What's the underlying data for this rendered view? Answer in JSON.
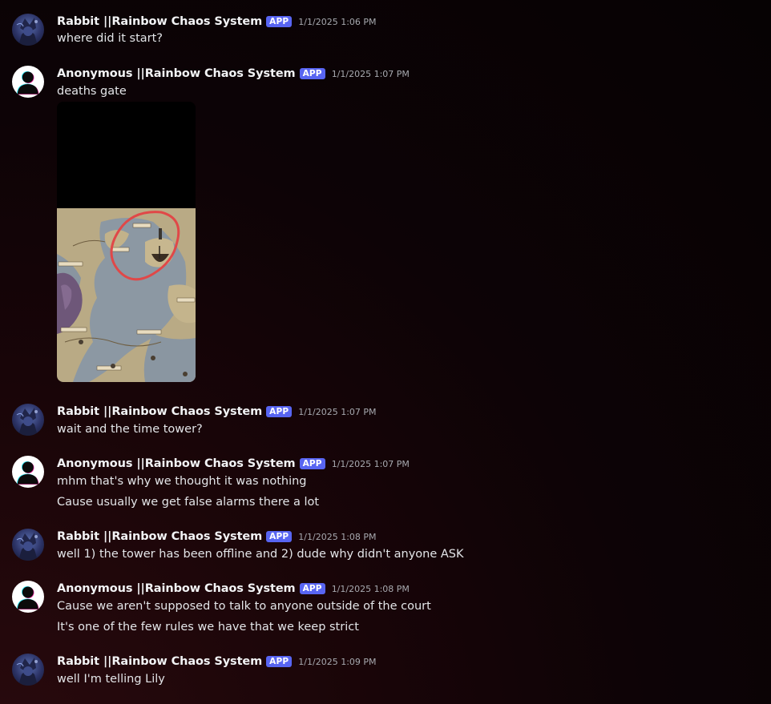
{
  "messages": [
    {
      "author": "Rabbit ||Rainbow Chaos System",
      "badge": "APP",
      "timestamp": "1/1/2025 1:06 PM",
      "lines": [
        "where did it start?"
      ]
    },
    {
      "author": "Anonymous ||Rainbow Chaos System",
      "badge": "APP",
      "timestamp": "1/1/2025 1:07 PM",
      "lines": [
        "deaths gate"
      ],
      "attachment": {
        "kind": "image",
        "subject": "map-with-red-circle"
      }
    },
    {
      "author": "Rabbit ||Rainbow Chaos System",
      "badge": "APP",
      "timestamp": "1/1/2025 1:07 PM",
      "lines": [
        "wait and the time tower?"
      ]
    },
    {
      "author": "Anonymous ||Rainbow Chaos System",
      "badge": "APP",
      "timestamp": "1/1/2025 1:07 PM",
      "lines": [
        "mhm that's why we thought it was nothing",
        "Cause usually we get false alarms there a lot"
      ]
    },
    {
      "author": "Rabbit ||Rainbow Chaos System",
      "badge": "APP",
      "timestamp": "1/1/2025 1:08 PM",
      "lines": [
        "well 1) the tower has been offline and 2) dude why didn't anyone ASK"
      ]
    },
    {
      "author": "Anonymous ||Rainbow Chaos System",
      "badge": "APP",
      "timestamp": "1/1/2025 1:08 PM",
      "lines": [
        "Cause we aren't supposed to talk to anyone outside of the court",
        "It's one of the few rules we have that we keep strict"
      ]
    },
    {
      "author": "Rabbit ||Rainbow Chaos System",
      "badge": "APP",
      "timestamp": "1/1/2025 1:09 PM",
      "lines": [
        "well I'm telling Lily"
      ]
    }
  ],
  "colors": {
    "app_badge": "#5865f2",
    "username": "#f2f3f5",
    "timestamp": "#a7a9af",
    "message_text": "#e3e5e8"
  }
}
